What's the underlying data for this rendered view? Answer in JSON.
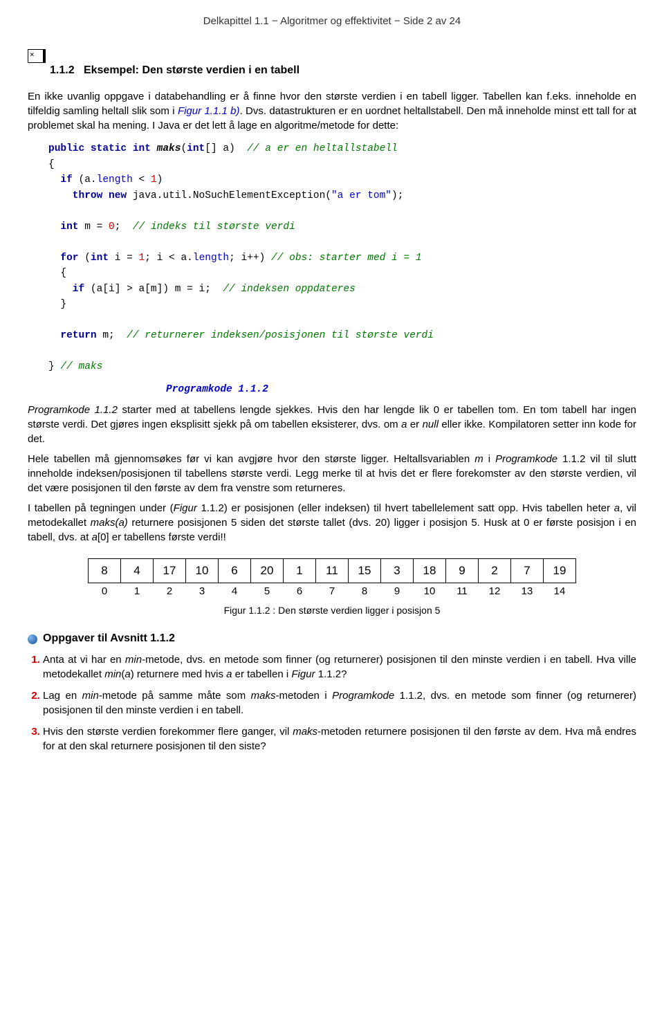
{
  "header": {
    "chapter": "Delkapittel 1.1",
    "sep1": " − ",
    "topic": "Algoritmer og effektivitet",
    "sep2": " − ",
    "page": "Side 2 av 24"
  },
  "section": {
    "number": "1.1.2",
    "title": "Eksempel: Den største verdien i en tabell"
  },
  "para1": {
    "t1": "En ikke uvanlig oppgave i databehandling er å finne hvor den største verdien i en tabell ligger. Tabellen kan f.eks. inneholde en tilfeldig samling heltall slik som i ",
    "figref": "Figur 1.1.1 b)",
    "t2": ". Dvs. datastrukturen er en uordnet heltallstabell. Den må inneholde minst ett tall for at problemet skal ha mening. I Java er det lett å lage en algoritme/metode for dette:"
  },
  "code": {
    "l1a": "public static int",
    "l1b": " maks",
    "l1c": "(",
    "l1d": "int",
    "l1e": "[] a)  ",
    "l1f": "// a er en heltallstabell",
    "l2": "{",
    "l3a": "  if",
    "l3b": " (a.",
    "l3c": "length",
    "l3d": " < ",
    "l3e": "1",
    "l3f": ")",
    "l4a": "    throw new",
    "l4b": " java.util.NoSuchElementException(",
    "l4c": "\"a er tom\"",
    "l4d": ");",
    "l5": "",
    "l6a": "  int",
    "l6b": " m = ",
    "l6c": "0",
    "l6d": ";  ",
    "l6e": "// indeks til største verdi",
    "l7": "",
    "l8a": "  for",
    "l8b": " (",
    "l8c": "int",
    "l8d": " i = ",
    "l8e": "1",
    "l8f": "; i < a.",
    "l8g": "length",
    "l8h": "; i++) ",
    "l8i": "// obs: starter med i = 1",
    "l9": "  {",
    "l10a": "    if",
    "l10b": " (a[i] > a[m]) m = i;  ",
    "l10c": "// indeksen oppdateres",
    "l11": "  }",
    "l12": "",
    "l13a": "  return",
    "l13b": " m;  ",
    "l13c": "// returnerer indeksen/posisjonen til største verdi",
    "l14": "",
    "l15a": "} ",
    "l15b": "// maks"
  },
  "codeLabel": "Programkode 1.1.2",
  "para2": {
    "t1": "Programkode 1.1.2",
    "t2": " starter med at tabellens lengde sjekkes. Hvis den har lengde lik 0 er tabellen tom. En tom tabell har ingen største verdi. Det gjøres ingen eksplisitt sjekk på om tabellen eksisterer, dvs. om ",
    "t3": "a",
    "t4": " er ",
    "t5": "null",
    "t6": " eller ikke. Kompilatoren setter inn kode for det."
  },
  "para3": {
    "t1": "Hele tabellen må gjennomsøkes før vi kan avgjøre hvor den største ligger. Heltallsvariablen ",
    "t2": "m",
    "t3": " i ",
    "t4": "Programkode",
    "t5": " 1.1.2 vil til slutt inneholde indeksen/posisjonen til tabellens største verdi. Legg merke til at hvis det er flere forekomster av den største verdien, vil det være posisjonen til den første av dem fra venstre som returneres."
  },
  "para4": {
    "t1": "I tabellen på tegningen under (",
    "t2": "Figur",
    "t3": " 1.1.2) er posisjonen (eller indeksen) til hvert tabellelement satt opp. Hvis tabellen heter ",
    "t4": "a",
    "t5": ", vil metodekallet ",
    "t6": "maks(a)",
    "t7": " returnere posisjonen 5 siden det største tallet (dvs. 20) ligger i posisjon 5. Husk at 0 er første posisjon i en tabell, dvs. at ",
    "t8": "a",
    "t9": "[0] er tabellens første verdi!!"
  },
  "table": {
    "values": [
      "8",
      "4",
      "17",
      "10",
      "6",
      "20",
      "1",
      "11",
      "15",
      "3",
      "18",
      "9",
      "2",
      "7",
      "19"
    ],
    "indices": [
      "0",
      "1",
      "2",
      "3",
      "4",
      "5",
      "6",
      "7",
      "8",
      "9",
      "10",
      "11",
      "12",
      "13",
      "14"
    ]
  },
  "figureCaption": "Figur 1.1.2 : Den største verdien ligger i posisjon 5",
  "tasksHeader": "Oppgaver til Avsnitt 1.1.2",
  "tasks": {
    "t1a": "Anta at vi har en ",
    "t1b": "min",
    "t1c": "-metode, dvs. en metode som finner (og returnerer) posisjonen til den minste verdien i en tabell. Hva ville metodekallet ",
    "t1d": "min",
    "t1e": "(",
    "t1f": "a",
    "t1g": ") returnere med hvis ",
    "t1h": "a",
    "t1i": " er tabellen i ",
    "t1j": "Figur",
    "t1k": " 1.1.2?",
    "t2a": "Lag en ",
    "t2b": "min",
    "t2c": "-metode på samme måte som ",
    "t2d": "maks",
    "t2e": "-metoden i ",
    "t2f": "Programkode",
    "t2g": " 1.1.2, dvs. en metode som finner (og returnerer) posisjonen til den minste verdien i en tabell.",
    "t3a": "Hvis den største verdien forekommer flere ganger, vil ",
    "t3b": "maks",
    "t3c": "-metoden returnere posisjonen til den første av dem. Hva må endres for at den skal returnere posisjonen til den siste?"
  }
}
